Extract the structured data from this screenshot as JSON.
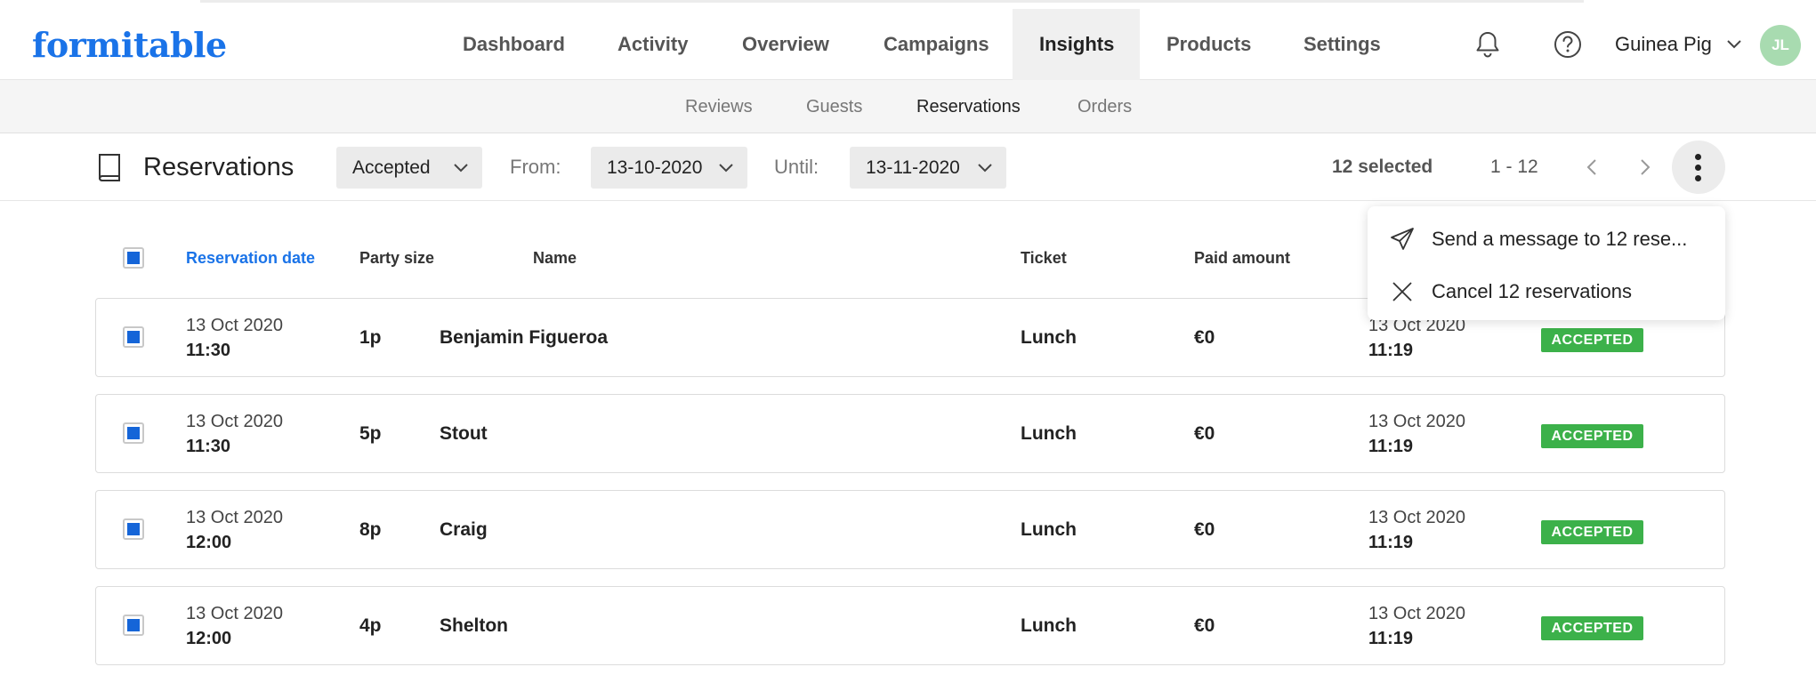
{
  "app": {
    "logo": "formitable"
  },
  "nav": {
    "items": [
      "Dashboard",
      "Activity",
      "Overview",
      "Campaigns",
      "Insights",
      "Products",
      "Settings"
    ],
    "active": "Insights"
  },
  "user": {
    "name": "Guinea Pig",
    "initials": "JL"
  },
  "subnav": {
    "items": [
      "Reviews",
      "Guests",
      "Reservations",
      "Orders"
    ],
    "active": "Reservations"
  },
  "toolbar": {
    "title": "Reservations",
    "status_filter": "Accepted",
    "from_label": "From:",
    "from_date": "13-10-2020",
    "until_label": "Until:",
    "until_date": "13-11-2020",
    "selected": "12 selected",
    "range": "1 - 12"
  },
  "menu": {
    "send_message": "Send a message to 12 rese...",
    "cancel": "Cancel 12 reservations"
  },
  "table": {
    "headers": {
      "reservation_date": "Reservation date",
      "party_size": "Party size",
      "name": "Name",
      "ticket": "Ticket",
      "paid_amount": "Paid amount"
    },
    "rows": [
      {
        "date": "13 Oct 2020",
        "time": "11:30",
        "party": "1p",
        "name": "Benjamin Figueroa",
        "ticket": "Lunch",
        "paid": "€0",
        "created_date": "13 Oct 2020",
        "created_time": "11:19",
        "status": "ACCEPTED"
      },
      {
        "date": "13 Oct 2020",
        "time": "11:30",
        "party": "5p",
        "name": "Stout",
        "ticket": "Lunch",
        "paid": "€0",
        "created_date": "13 Oct 2020",
        "created_time": "11:19",
        "status": "ACCEPTED"
      },
      {
        "date": "13 Oct 2020",
        "time": "12:00",
        "party": "8p",
        "name": "Craig",
        "ticket": "Lunch",
        "paid": "€0",
        "created_date": "13 Oct 2020",
        "created_time": "11:19",
        "status": "ACCEPTED"
      },
      {
        "date": "13 Oct 2020",
        "time": "12:00",
        "party": "4p",
        "name": "Shelton",
        "ticket": "Lunch",
        "paid": "€0",
        "created_date": "13 Oct 2020",
        "created_time": "11:19",
        "status": "ACCEPTED"
      }
    ]
  },
  "colors": {
    "brand": "#1a73e8",
    "checkbox": "#1565d8",
    "badge": "#3cb14a",
    "avatar": "#a8dbb0"
  }
}
